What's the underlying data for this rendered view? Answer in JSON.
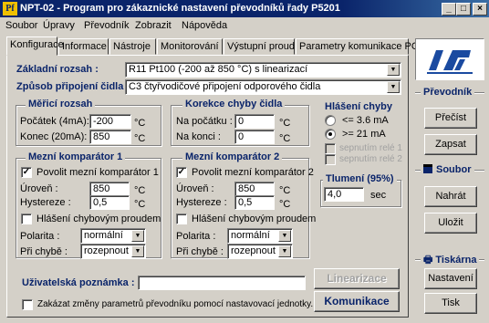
{
  "window": {
    "title": "NPT-02 - Program pro zákaznické nastavení převodníků řady P5201",
    "app_icon_text": "Pf",
    "min_glyph": "_",
    "max_glyph": "□",
    "close_glyph": "×"
  },
  "menu": [
    {
      "label": "Soubor"
    },
    {
      "label": "Úpravy"
    },
    {
      "label": "Převodník"
    },
    {
      "label": "Zobrazit"
    },
    {
      "label": "Nápověda"
    }
  ],
  "tabs": [
    {
      "label": "Konfigurace",
      "active": true
    },
    {
      "label": "Informace"
    },
    {
      "label": "Nástroje"
    },
    {
      "label": "Monitorování"
    },
    {
      "label": "Výstupní proud"
    },
    {
      "label": "Parametry komunikace PC"
    }
  ],
  "config": {
    "basic_range_label": "Základní rozsah :",
    "basic_range_value": "R11  Pt100 (-200 až 850 °C) s linearizací",
    "connection_label": "Způsob připojení čidla :",
    "connection_value": "C3  čtyřvodičové připojení odporového čidla"
  },
  "measuring_range": {
    "title": "Měřicí rozsah",
    "start_label": "Počátek (4mA):",
    "start_value": "-200",
    "end_label": "Konec (20mA):",
    "end_value": "850",
    "unit": "°C"
  },
  "correction": {
    "title": "Korekce chyby čidla",
    "start_label": "Na počátku :",
    "start_value": "0",
    "end_label": "Na konci :",
    "end_value": "0",
    "unit": "°C"
  },
  "error_report": {
    "title": "Hlášení chyby",
    "option1": "<= 3.6 mA",
    "option2": ">= 21 mA",
    "selected": 2,
    "relay1": "sepnutím relé 1",
    "relay2": "sepnutím relé 2"
  },
  "damping": {
    "title": "Tlumení (95%)",
    "value": "4,0",
    "unit": "sec"
  },
  "comparator1": {
    "title": "Mezní komparátor 1",
    "enable_label": "Povolit mezní komparátor 1",
    "enabled": true,
    "level_label": "Úroveň :",
    "level_value": "850",
    "hyst_label": "Hystereze :",
    "hyst_value": "0,5",
    "unit": "°C",
    "error_current_label": "Hlášení chybovým proudem",
    "polarity_label": "Polarita :",
    "polarity_value": "normální",
    "on_error_label": "Při chybě :",
    "on_error_value": "rozepnout"
  },
  "comparator2": {
    "title": "Mezní komparátor 2",
    "enable_label": "Povolit mezní komparátor 2",
    "enabled": true,
    "level_label": "Úroveň :",
    "level_value": "850",
    "hyst_label": "Hystereze :",
    "hyst_value": "0,5",
    "unit": "°C",
    "error_current_label": "Hlášení chybovým proudem",
    "polarity_label": "Polarita :",
    "polarity_value": "normální",
    "on_error_label": "Při chybě :",
    "on_error_value": "rozepnout"
  },
  "user_note": {
    "label": "Uživatelská poznámka :",
    "value": ""
  },
  "lock_label": "Zakázat změny parametrů převodníku pomocí nastavovací jednotky.",
  "buttons": {
    "linearization": "Linearizace",
    "communication": "Komunikace"
  },
  "sidebar": {
    "converter_title": "Převodník",
    "read": "Přečíst",
    "write": "Zapsat",
    "file_title": "Soubor",
    "load": "Nahrát",
    "save": "Uložit",
    "printer_title": "Tiskárna",
    "setup": "Nastavení",
    "print": "Tisk"
  },
  "logo": {
    "text": "JSP",
    "color": "#1a4aa0"
  },
  "colors": {
    "titlebar": "#0a246a",
    "face": "#d4d0c8",
    "accent_text": "#0a246a"
  }
}
